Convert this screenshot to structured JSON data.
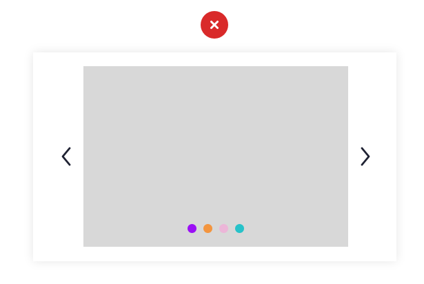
{
  "close_button": {
    "icon": "close-icon",
    "color": "#d92a2a"
  },
  "carousel": {
    "slide_color": "#d8d8d8",
    "prev_icon": "chevron-left-icon",
    "next_icon": "chevron-right-icon",
    "arrow_color": "#1f2233",
    "dots": [
      {
        "color": "#9b10f5",
        "active": true
      },
      {
        "color": "#f3953f",
        "active": false
      },
      {
        "color": "#ecb6d8",
        "active": false
      },
      {
        "color": "#27c2c9",
        "active": false
      }
    ]
  }
}
